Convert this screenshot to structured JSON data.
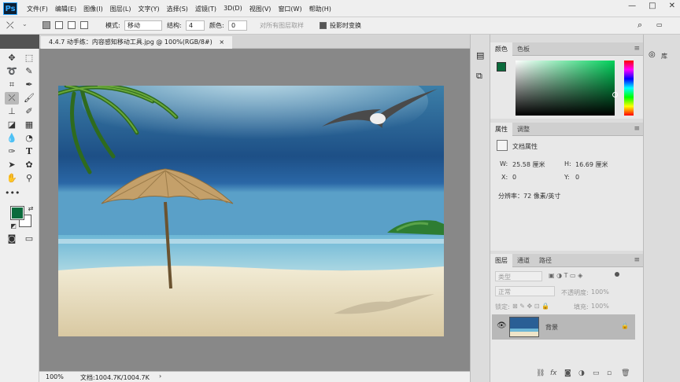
{
  "app": {
    "logo": "Ps"
  },
  "menu": [
    "文件(F)",
    "编辑(E)",
    "图像(I)",
    "图层(L)",
    "文字(Y)",
    "选择(S)",
    "滤镜(T)",
    "3D(D)",
    "视图(V)",
    "窗口(W)",
    "帮助(H)"
  ],
  "window_controls": {
    "minimize": "—",
    "maximize": "□",
    "close": "✕"
  },
  "options": {
    "mode_label": "模式:",
    "mode_value": "移动",
    "structure_label": "结构:",
    "structure_value": "4",
    "color_label": "颜色:",
    "color_value": "0",
    "sample_all_layers": "对所有图层取样",
    "transform_on_drop": "投影时变换"
  },
  "document": {
    "tab_title": "4.4.7 动手练：内容感知移动工具.jpg @ 100%(RGB/8#)",
    "tab_close": "×"
  },
  "status": {
    "zoom": "100%",
    "doc_size": "文档:1004.7K/1004.7K"
  },
  "color_panel": {
    "tab_color": "颜色",
    "tab_swatches": "色板",
    "foreground": "#0b6b3c"
  },
  "properties_panel": {
    "tab_properties": "属性",
    "tab_adjustments": "调整",
    "heading": "文档属性",
    "w_label": "W:",
    "w_value": "25.58 厘米",
    "h_label": "H:",
    "h_value": "16.69 厘米",
    "x_label": "X:",
    "x_value": "0",
    "y_label": "Y:",
    "y_value": "0",
    "resolution": "分辨率：72 像素/英寸"
  },
  "layers_panel": {
    "tab_layers": "图层",
    "tab_channels": "通道",
    "tab_paths": "路径",
    "filter_kind": "类型",
    "blend_mode": "正常",
    "opacity_label": "不透明度:",
    "opacity_value": "100%",
    "lock_label": "锁定:",
    "fill_label": "填充:",
    "fill_value": "100%",
    "layers": [
      {
        "name": "背景",
        "visible": true,
        "locked": true
      }
    ]
  },
  "libraries": {
    "label": "库"
  }
}
